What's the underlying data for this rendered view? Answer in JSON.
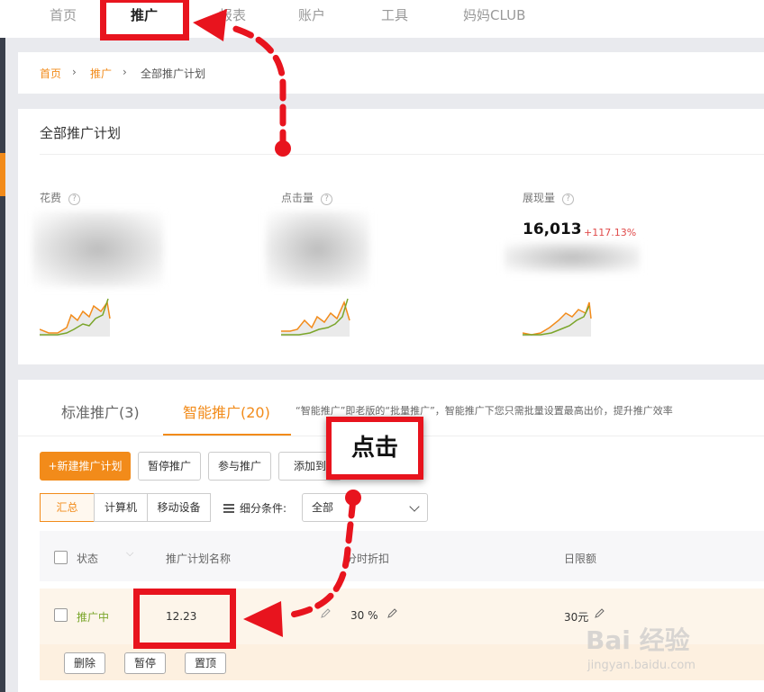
{
  "topnav": {
    "items": [
      "首页",
      "推广",
      "报表",
      "账户",
      "工具",
      "妈妈CLUB"
    ],
    "active": "推广"
  },
  "breadcrumb": {
    "home": "首页",
    "promo": "推广",
    "current": "全部推广计划"
  },
  "overview": {
    "title": "全部推广计划",
    "metrics": [
      {
        "label": "花费",
        "help": "?"
      },
      {
        "label": "点击量",
        "help": "?"
      },
      {
        "label": "展现量",
        "help": "?",
        "value": "16,013",
        "change": "+117.13%"
      }
    ]
  },
  "campaigns": {
    "tabs": [
      "标准推广(3)",
      "智能推广(20)"
    ],
    "active_tab": "智能推广(20)",
    "tab_note": "“智能推广”即老版的“批量推广”，智能推广下您只需批量设置最高出价，提升推广效率",
    "buttons": [
      "+新建推广计划",
      "暂停推广",
      "参与推广",
      "添加到"
    ],
    "segments": [
      "汇总",
      "计算机",
      "移动设备"
    ],
    "active_segment": "汇总",
    "filter_label": "细分条件:",
    "filter_value": "全部",
    "columns": [
      "状态",
      "推广计划名称",
      "分时折扣",
      "日限额"
    ],
    "row": {
      "status": "推广中",
      "name": "12.23",
      "discount": "30 %",
      "budget": "30元"
    },
    "row_actions": [
      "删除",
      "暂停",
      "置顶"
    ]
  },
  "annotations": {
    "click_note": "点击",
    "accent_color": "#e8141e"
  },
  "watermark": {
    "main": "Bai 经验",
    "sub": "jingyan.baidu.com"
  },
  "colors": {
    "brand": "#f28b1a",
    "status_green": "#7aa52a",
    "increase_red": "#e04a4a"
  }
}
